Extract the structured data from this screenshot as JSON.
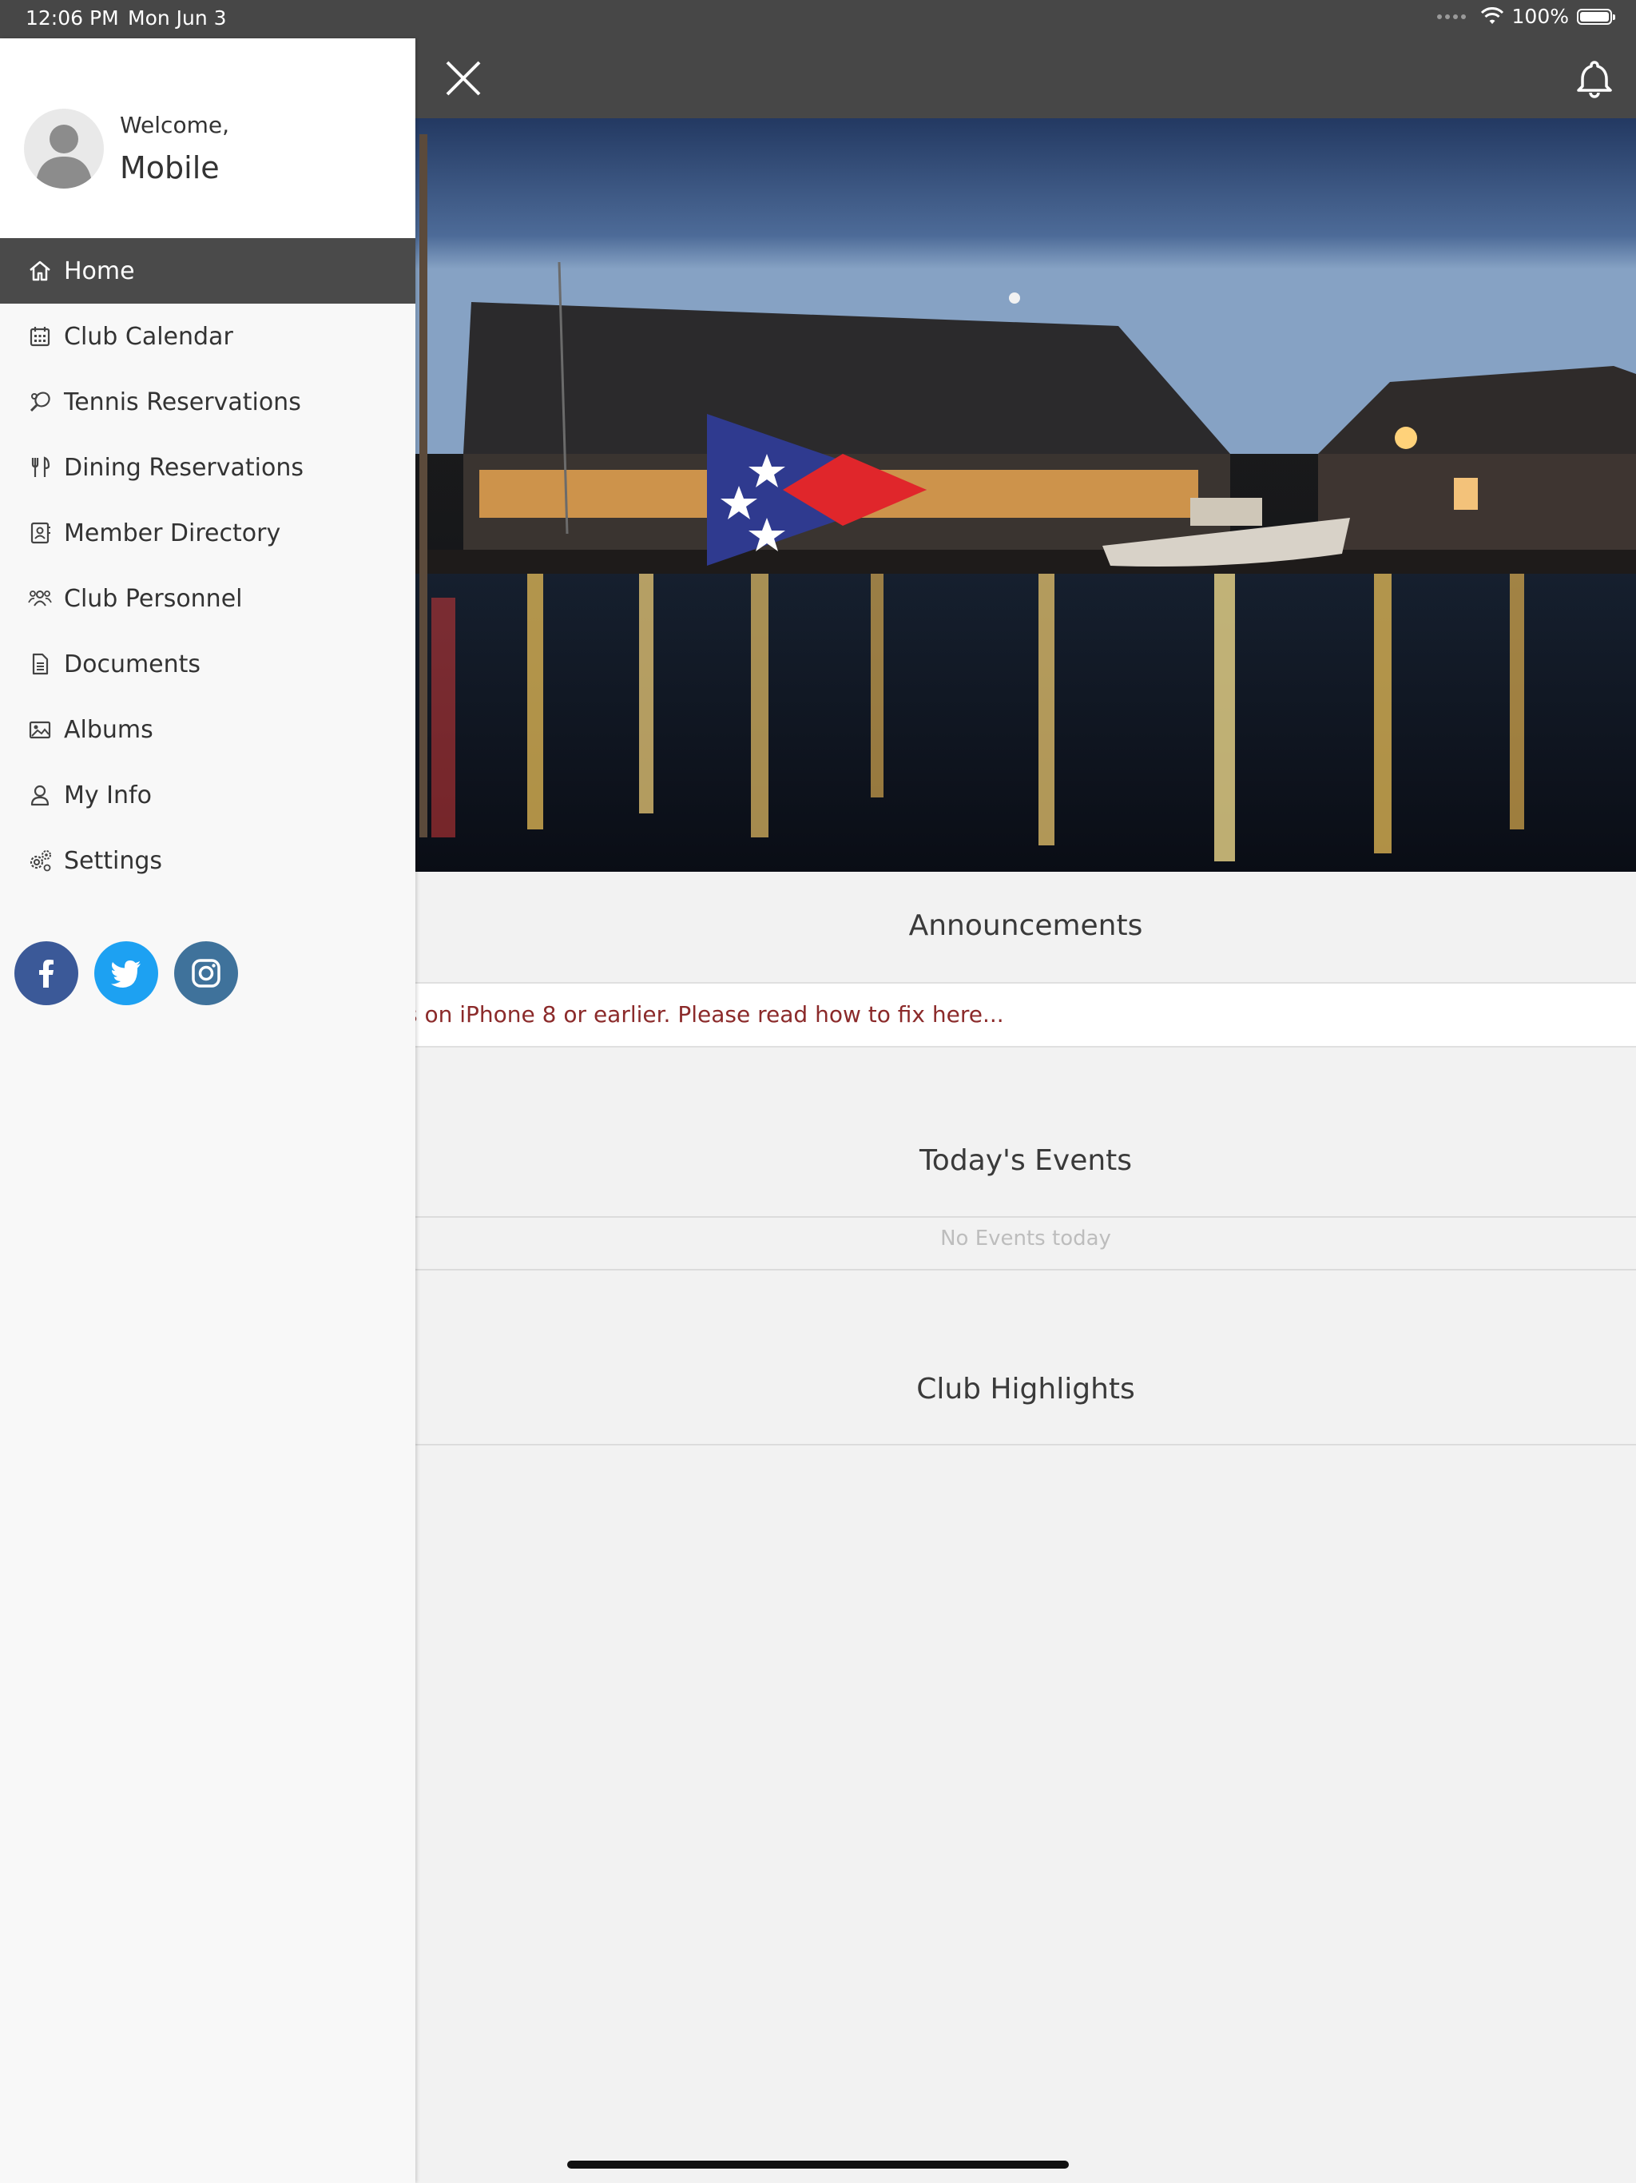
{
  "status_bar": {
    "time": "12:06 PM",
    "date": "Mon Jun 3",
    "battery": "100%"
  },
  "sidebar": {
    "welcome": "Welcome,",
    "username": "Mobile",
    "items": [
      {
        "label": "Home",
        "icon": "home-icon",
        "active": true
      },
      {
        "label": "Club Calendar",
        "icon": "calendar-icon"
      },
      {
        "label": "Tennis Reservations",
        "icon": "tennis-racket-icon"
      },
      {
        "label": "Dining Reservations",
        "icon": "utensils-icon"
      },
      {
        "label": "Member Directory",
        "icon": "address-book-icon"
      },
      {
        "label": "Club Personnel",
        "icon": "users-icon"
      },
      {
        "label": "Documents",
        "icon": "document-icon"
      },
      {
        "label": "Albums",
        "icon": "image-icon"
      },
      {
        "label": "My Info",
        "icon": "user-icon"
      },
      {
        "label": "Settings",
        "icon": "gears-icon"
      }
    ],
    "socials": [
      "facebook-icon",
      "twitter-icon",
      "instagram-icon"
    ]
  },
  "main": {
    "announcements_title": "Announcements",
    "announcement_text": "s on iPhone 8 or earlier. Please read how to fix here...",
    "events_title": "Today's Events",
    "no_events": "No Events today",
    "highlights_title": "Club Highlights"
  },
  "colors": {
    "header": "#474747",
    "active_menu": "#4a4a4a",
    "announcement_text": "#8b2a2a",
    "burgee_blue": "#2f3a8f",
    "burgee_red": "#e0262b"
  }
}
